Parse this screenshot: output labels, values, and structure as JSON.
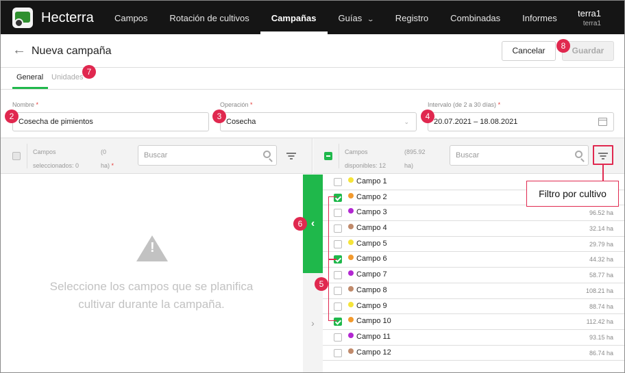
{
  "app": {
    "name": "Hecterra",
    "logo_icon": "tractor-icon"
  },
  "nav": [
    {
      "label": "Campos"
    },
    {
      "label": "Rotación de cultivos"
    },
    {
      "label": "Campañas",
      "active": true
    },
    {
      "label": "Guías",
      "dropdown": true
    },
    {
      "label": "Registro"
    },
    {
      "label": "Combinadas"
    },
    {
      "label": "Informes"
    }
  ],
  "user": {
    "name": "terra1",
    "account": "terra1"
  },
  "header": {
    "title": "Nueva campaña",
    "cancel_label": "Cancelar",
    "save_label": "Guardar"
  },
  "tabs": {
    "general": "General",
    "units": "Unidades"
  },
  "form": {
    "name_label": "Nombre",
    "name_value": "Cosecha de pimientos",
    "operation_label": "Operación",
    "operation_value": "Cosecha",
    "interval_label": "Intervalo (de 2 a 30 días)",
    "interval_value": "20.07.2021 – 18.08.2021",
    "required_mark": "*"
  },
  "selected_panel": {
    "label_line1": "Campos",
    "label_line2": "seleccionados: 0",
    "area_line1": "(0",
    "area_line2": "ha)",
    "required_mark": "*",
    "search_placeholder": "Buscar",
    "empty_line1": "Seleccione los campos que se planifica",
    "empty_line2": "cultivar durante la campaña."
  },
  "available_panel": {
    "label_line1": "Campos",
    "label_line2": "disponibles: 12",
    "area_line1": "(895.92",
    "area_line2": "ha)",
    "search_placeholder": "Buscar",
    "fields": [
      {
        "name": "Campo 1",
        "area": "",
        "color": "#f5e43a",
        "checked": false
      },
      {
        "name": "Campo 2",
        "area": "",
        "color": "#f29a2e",
        "checked": true
      },
      {
        "name": "Campo 3",
        "area": "96.52 ha",
        "color": "#b227d1",
        "checked": false
      },
      {
        "name": "Campo 4",
        "area": "32.14 ha",
        "color": "#c08a6b",
        "checked": false
      },
      {
        "name": "Campo 5",
        "area": "29.79 ha",
        "color": "#f5e43a",
        "checked": false
      },
      {
        "name": "Campo 6",
        "area": "44.32 ha",
        "color": "#f29a2e",
        "checked": true
      },
      {
        "name": "Campo 7",
        "area": "58.77 ha",
        "color": "#b227d1",
        "checked": false
      },
      {
        "name": "Campo 8",
        "area": "108.21 ha",
        "color": "#c08a6b",
        "checked": false
      },
      {
        "name": "Campo 9",
        "area": "88.74 ha",
        "color": "#f5e43a",
        "checked": false
      },
      {
        "name": "Campo 10",
        "area": "112.42 ha",
        "color": "#f29a2e",
        "checked": true
      },
      {
        "name": "Campo 11",
        "area": "93.15 ha",
        "color": "#b227d1",
        "checked": false
      },
      {
        "name": "Campo 12",
        "area": "86.74 ha",
        "color": "#c08a6b",
        "checked": false
      }
    ]
  },
  "annotations": {
    "n2": "2",
    "n3": "3",
    "n4": "4",
    "n5": "5",
    "n6": "6",
    "n7": "7",
    "n8": "8",
    "filter_callout": "Filtro por cultivo"
  },
  "colors": {
    "accent": "#1fb84b",
    "annotation": "#e0284f",
    "topbar": "#151515"
  }
}
